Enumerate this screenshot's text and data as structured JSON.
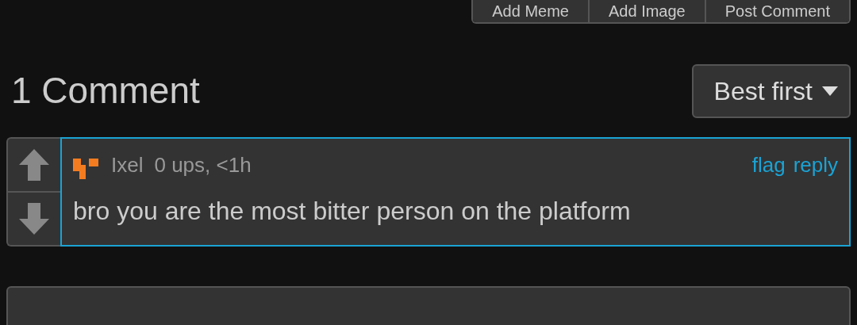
{
  "actions": [
    "Add Meme",
    "Add Image",
    "Post Comment"
  ],
  "heading": "1 Comment",
  "sort": {
    "label": "Best first"
  },
  "comments": [
    {
      "author": "Ixel",
      "meta": "0 ups, <1h",
      "links": [
        "flag",
        "reply"
      ],
      "text": "bro you are the most bitter person on the platform"
    }
  ]
}
